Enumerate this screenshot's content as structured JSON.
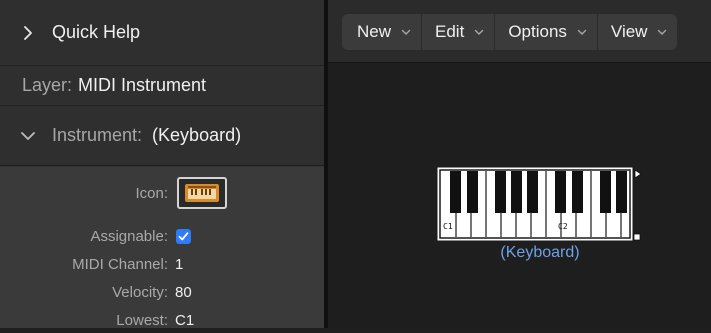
{
  "inspector": {
    "quick_help_label": "Quick Help",
    "layer_label": "Layer:",
    "layer_value": "MIDI Instrument",
    "instrument_label": "Instrument:",
    "instrument_value": "(Keyboard)",
    "params": [
      {
        "label": "Icon:"
      },
      {
        "label": "Assignable:"
      },
      {
        "label": "MIDI Channel:",
        "value": "1"
      },
      {
        "label": "Velocity:",
        "value": "80"
      },
      {
        "label": "Lowest:",
        "value": "C1"
      }
    ],
    "assignable_checked": true
  },
  "toolbar": {
    "menus": [
      "New",
      "Edit",
      "Options",
      "View"
    ]
  },
  "environment": {
    "object_name": "(Keyboard)",
    "key_labels": [
      "C1",
      "C2"
    ]
  },
  "colors": {
    "accent": "#2e7cf6",
    "object_name": "#6ea0e6",
    "icon_orange": "#d98a2b"
  }
}
